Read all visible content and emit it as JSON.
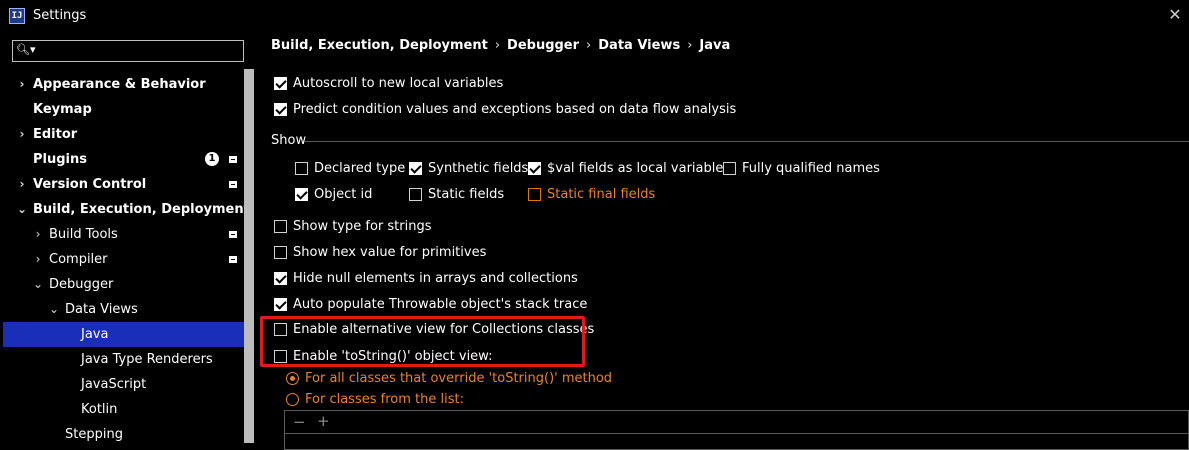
{
  "window": {
    "title": "Settings",
    "app_icon": "IJ",
    "close_glyph": "✕"
  },
  "sidebar": {
    "search": {
      "value": "",
      "icon": "search-icon"
    },
    "items": [
      {
        "label": "Appearance & Behavior",
        "chevron": "›"
      },
      {
        "label": "Keymap",
        "chevron": ""
      },
      {
        "label": "Editor",
        "chevron": "›"
      },
      {
        "label": "Plugins",
        "chevron": "",
        "badge": "1"
      },
      {
        "label": "Version Control",
        "chevron": "›"
      },
      {
        "label": "Build, Execution, Deployment",
        "chevron": "⌄"
      },
      {
        "label": "Build Tools",
        "chevron": "›"
      },
      {
        "label": "Compiler",
        "chevron": "›"
      },
      {
        "label": "Debugger",
        "chevron": "⌄"
      },
      {
        "label": "Data Views",
        "chevron": "⌄"
      },
      {
        "label": "Java",
        "chevron": ""
      },
      {
        "label": "Java Type Renderers",
        "chevron": ""
      },
      {
        "label": "JavaScript",
        "chevron": ""
      },
      {
        "label": "Kotlin",
        "chevron": ""
      },
      {
        "label": "Stepping",
        "chevron": ""
      }
    ]
  },
  "breadcrumb": [
    "Build, Execution, Deployment",
    "Debugger",
    "Data Views",
    "Java"
  ],
  "breadcrumb_sep": "›",
  "options": {
    "autoscroll": {
      "label": "Autoscroll to new local variables",
      "checked": true
    },
    "predict": {
      "label": "Predict condition values and exceptions based on data flow analysis",
      "checked": true
    },
    "show_section": "Show",
    "show": {
      "declared_type": {
        "label": "Declared type",
        "checked": false
      },
      "synthetic_fields": {
        "label": "Synthetic fields",
        "checked": true
      },
      "val_fields": {
        "label": "$val fields as local variables",
        "checked": true
      },
      "fully_qualified": {
        "label": "Fully qualified names",
        "checked": false
      },
      "object_id": {
        "label": "Object id",
        "checked": true
      },
      "static_fields": {
        "label": "Static fields",
        "checked": false
      },
      "static_final_fields": {
        "label": "Static final fields",
        "checked": false,
        "enabled": false
      }
    },
    "show_type_strings": {
      "label": "Show type for strings",
      "checked": false
    },
    "show_hex": {
      "label": "Show hex value for primitives",
      "checked": false
    },
    "hide_null": {
      "label": "Hide null elements in arrays and collections",
      "checked": true
    },
    "auto_populate": {
      "label": "Auto populate Throwable object's stack trace",
      "checked": true
    },
    "alt_view": {
      "label": "Enable alternative view for Collections classes",
      "checked": false
    },
    "tostring_view": {
      "label": "Enable 'toString()' object view:",
      "checked": false
    },
    "radio_all": {
      "label": "For all classes that override 'toString()' method",
      "selected": true
    },
    "radio_list": {
      "label": "For classes from the list:",
      "selected": false
    },
    "list_toolbar": {
      "remove": "−",
      "add": "+"
    }
  },
  "colors": {
    "selection": "#1a2fb8",
    "disabled_text": "#e8832a",
    "highlight": "#e01b1b"
  }
}
